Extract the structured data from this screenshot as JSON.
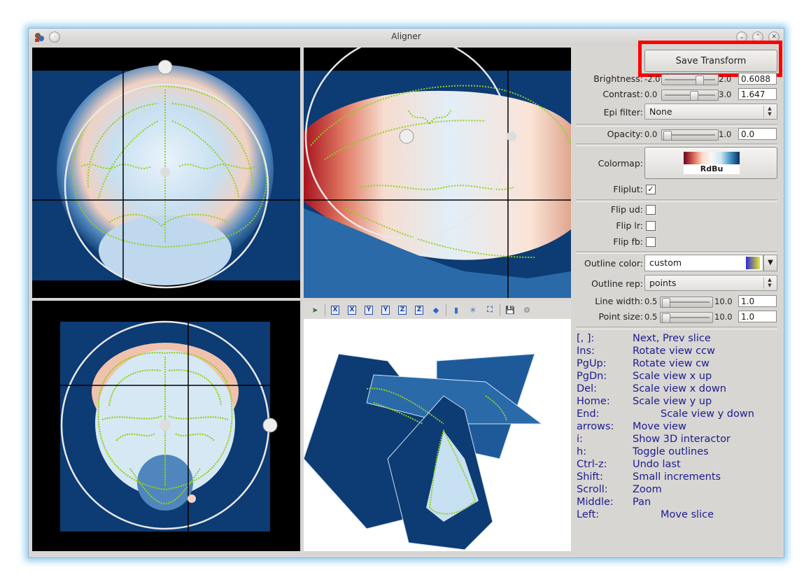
{
  "window": {
    "title": "Aligner"
  },
  "toolbar3d": {
    "buttons": [
      {
        "name": "pick-icon",
        "glyph": "➤"
      },
      {
        "name": "view-x-pos-button",
        "glyph": "X"
      },
      {
        "name": "view-x-neg-button",
        "glyph": "X"
      },
      {
        "name": "view-y-pos-button",
        "glyph": "Y"
      },
      {
        "name": "view-y-neg-button",
        "glyph": "Y"
      },
      {
        "name": "view-z-pos-button",
        "glyph": "Z"
      },
      {
        "name": "view-z-neg-button",
        "glyph": "Z"
      },
      {
        "name": "isometric-view-button",
        "glyph": "◆"
      },
      {
        "name": "orthographic-button",
        "glyph": "▮"
      },
      {
        "name": "axes-button",
        "glyph": "✳"
      },
      {
        "name": "fit-view-button",
        "glyph": "⛶"
      },
      {
        "name": "save-image-button",
        "glyph": "💾"
      },
      {
        "name": "settings-button",
        "glyph": "⚙"
      }
    ]
  },
  "panel": {
    "save_transform": "Save Transform",
    "brightness": {
      "label": "Brightness:",
      "min": "-2.0",
      "max": "2.0",
      "value": "0.6088"
    },
    "contrast": {
      "label": "Contrast:",
      "min": "0.0",
      "max": "3.0",
      "value": "1.647"
    },
    "epi_filter": {
      "label": "Epi filter:",
      "value": "None"
    },
    "opacity": {
      "label": "Opacity:",
      "min": "0.0",
      "max": "1.0",
      "value": "0.0"
    },
    "colormap": {
      "label": "Colormap:",
      "value": "RdBu"
    },
    "fliplut": {
      "label": "Fliplut:",
      "checked": "✓"
    },
    "flip_ud": {
      "label": "Flip ud:"
    },
    "flip_lr": {
      "label": "Flip lr:"
    },
    "flip_fb": {
      "label": "Flip fb:"
    },
    "outline_color": {
      "label": "Outline color:",
      "value": "custom"
    },
    "outline_rep": {
      "label": "Outline rep:",
      "value": "points"
    },
    "line_width": {
      "label": "Line width:",
      "min": "0.5",
      "max": "10.0",
      "value": "1.0"
    },
    "point_size": {
      "label": "Point size:",
      "min": "0.5",
      "max": "10.0",
      "value": "1.0"
    }
  },
  "help": [
    {
      "key": "[, ]:",
      "desc": "Next, Prev slice"
    },
    {
      "key": "Ins:",
      "desc": "Rotate view ccw"
    },
    {
      "key": "PgUp:",
      "desc": "Rotate view cw"
    },
    {
      "key": "PgDn:",
      "desc": "Scale view x up"
    },
    {
      "key": "Del:",
      "desc": "Scale view x down"
    },
    {
      "key": "Home:",
      "desc": "Scale view y up"
    },
    {
      "key": "End:",
      "desc": "Scale view y down"
    },
    {
      "key": "arrows:",
      "desc": "Move view"
    },
    {
      "key": "i:",
      "desc": "Show 3D interactor"
    },
    {
      "key": "h:",
      "desc": "Toggle outlines"
    },
    {
      "key": "Ctrl-z:",
      "desc": "Undo last"
    },
    {
      "key": "Shift:",
      "desc": "Small increments"
    },
    {
      "key": "Scroll:",
      "desc": "Zoom"
    },
    {
      "key": "Middle:",
      "desc": "Pan"
    },
    {
      "key": "Left:",
      "desc": "Move slice"
    }
  ],
  "colors": {
    "highlight": "#ff0000",
    "help_text": "#1c1c8c",
    "overlay": "#8fd11a",
    "brain_bg": "#0d3b73"
  }
}
